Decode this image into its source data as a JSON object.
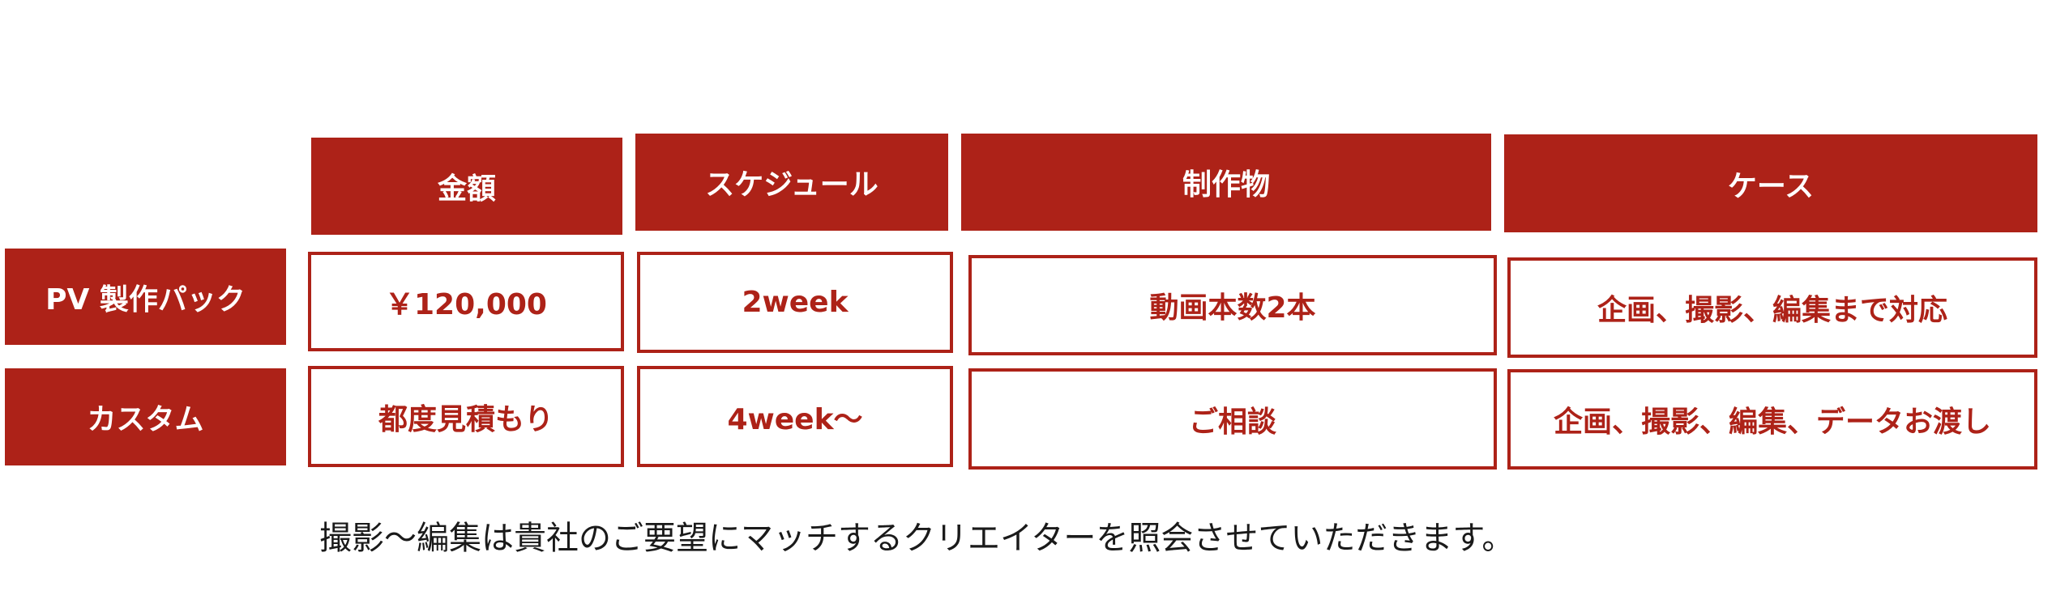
{
  "colors": {
    "accent": "#ad2218",
    "header_text": "#ffffff",
    "note_text": "#1a1a1a"
  },
  "table": {
    "headers": [
      "金額",
      "スケジュール",
      "制作物",
      "ケース"
    ],
    "rows": [
      {
        "label": "PV 製作パック",
        "cells": [
          "￥120,000",
          "2week",
          "動画本数2本",
          "企画、撮影、編集まで対応"
        ]
      },
      {
        "label": "カスタム",
        "cells": [
          "都度見積もり",
          "4week〜",
          "ご相談",
          "企画、撮影、編集、データお渡し"
        ]
      }
    ]
  },
  "note": "撮影〜編集は貴社のご要望にマッチするクリエイターを照会させていただきます。"
}
